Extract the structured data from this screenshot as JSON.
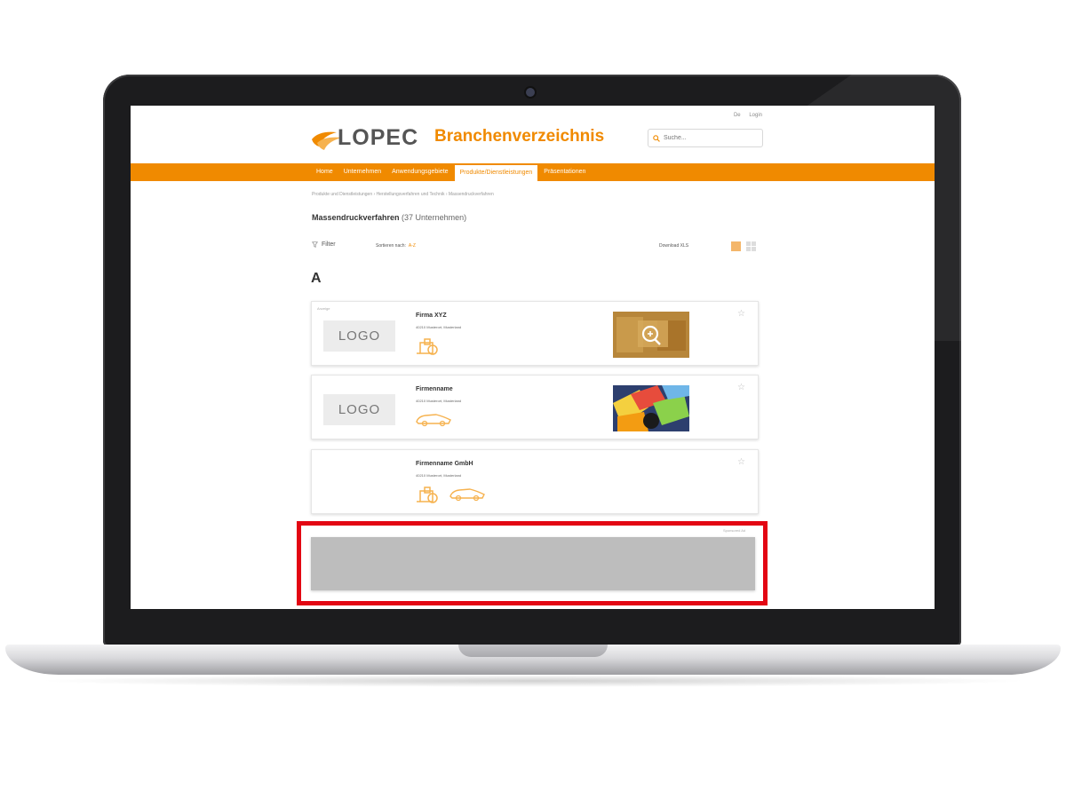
{
  "topbar": {
    "language": "De",
    "login": "Login"
  },
  "brand": {
    "logo_text": "LOPEC",
    "title": "Branchenverzeichnis"
  },
  "search": {
    "placeholder": "Suche..."
  },
  "nav": {
    "items": [
      {
        "label": "Home",
        "active": false
      },
      {
        "label": "Unternehmen",
        "active": false
      },
      {
        "label": "Anwendungsgebiete",
        "active": false
      },
      {
        "label": "Produkte/Dienstleistungen",
        "active": true
      },
      {
        "label": "Präsentationen",
        "active": false
      }
    ]
  },
  "breadcrumb": "Produkte und Dienstleistungen › Herstellungsverfahren und Technik › Massendruckverfahren",
  "page": {
    "title": "Massendruckverfahren",
    "count": " (37 Unternehmen)"
  },
  "toolbar": {
    "filter": "Filter",
    "sort_label": "Sortieren nach:",
    "sort_value": "A-Z",
    "download": "Download XLS"
  },
  "section_letter": "A",
  "cards": [
    {
      "tag": "Anzeige",
      "logo": "LOGO",
      "company": "Firma XYZ",
      "address": "40210 Musterort, Musterland",
      "icons": [
        "printed-device-icon"
      ],
      "image": "magnifier-thumbnail"
    },
    {
      "tag": "",
      "logo": "LOGO",
      "company": "Firmenname",
      "address": "40210 Musterort, Musterland",
      "icons": [
        "car-icon"
      ],
      "image": "printed-colors-thumbnail"
    },
    {
      "tag": "",
      "logo": "",
      "company": "Firmenname GmbH",
      "address": "40210 Musterort, Musterland",
      "icons": [
        "printed-device-icon",
        "car-icon"
      ],
      "image": ""
    }
  ],
  "ad": {
    "label": "Sponsored Ad"
  },
  "colors": {
    "accent": "#f08a00",
    "highlight": "#e30613",
    "ad_placeholder": "#bdbdbd"
  }
}
